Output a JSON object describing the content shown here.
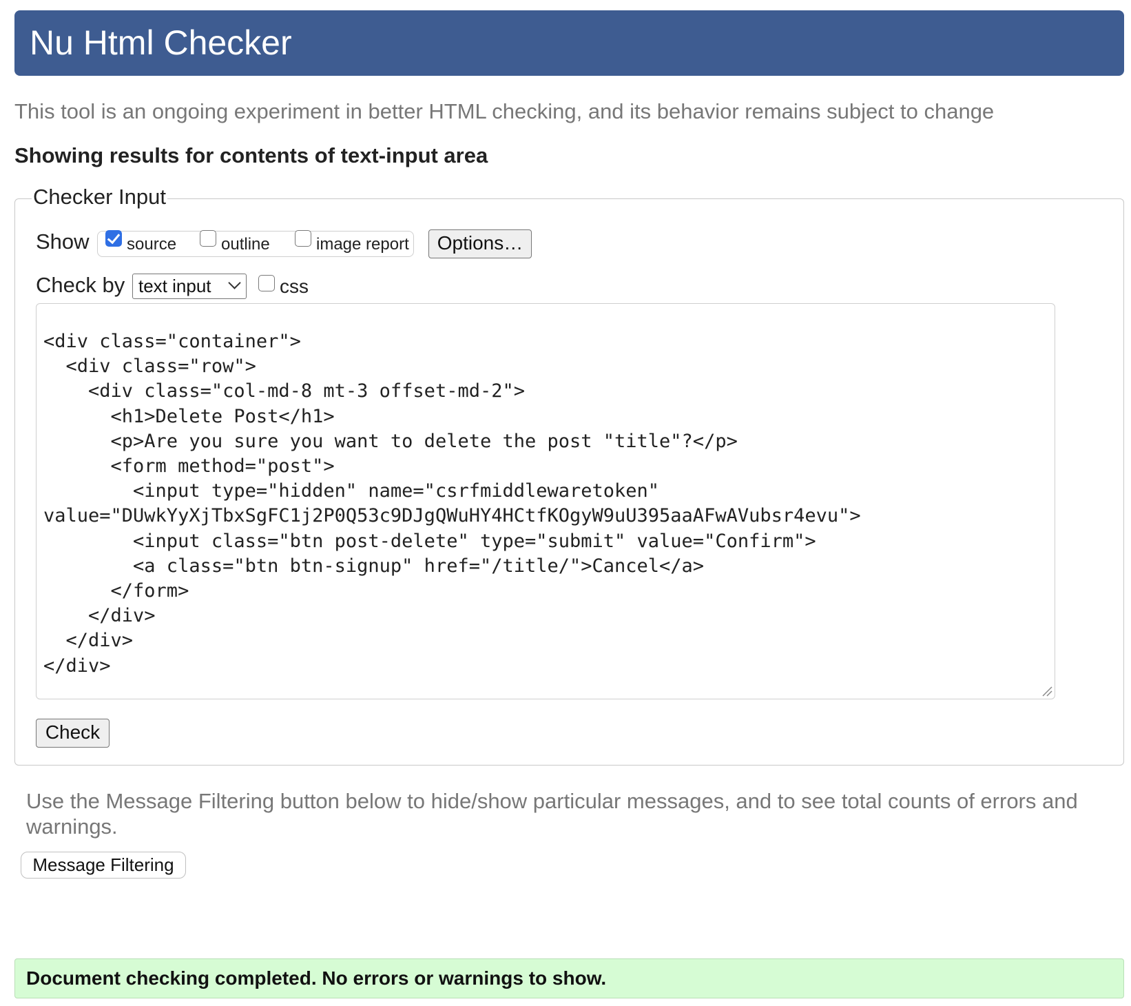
{
  "header": {
    "title": "Nu Html Checker"
  },
  "tagline": "This tool is an ongoing experiment in better HTML checking, and its behavior remains subject to change",
  "results_heading": "Showing results for contents of text-input area",
  "checker_input": {
    "legend": "Checker Input",
    "show_label": "Show",
    "show_options": [
      {
        "label": "source",
        "checked": true
      },
      {
        "label": "outline",
        "checked": false
      },
      {
        "label": "image report",
        "checked": false
      }
    ],
    "options_button": "Options…",
    "check_by_label": "Check by",
    "check_by_selected": "text input",
    "css_label": "css",
    "css_checked": false,
    "source_text": "<div class=\"container\">\n  <div class=\"row\">\n    <div class=\"col-md-8 mt-3 offset-md-2\">\n      <h1>Delete Post</h1>\n      <p>Are you sure you want to delete the post \"title\"?</p>\n      <form method=\"post\">\n        <input type=\"hidden\" name=\"csrfmiddlewaretoken\"\nvalue=\"DUwkYyXjTbxSgFC1j2P0Q53c9DJgQWuHY4HCtfKOgyW9uU395aaAFwAVubsr4evu\">\n        <input class=\"btn post-delete\" type=\"submit\" value=\"Confirm\">\n        <a class=\"btn btn-signup\" href=\"/title/\">Cancel</a>\n      </form>\n    </div>\n  </div>\n</div>",
    "check_button": "Check"
  },
  "filter_note": "Use the Message Filtering button below to hide/show particular messages, and to see total counts of errors and warnings.",
  "filter_button": "Message Filtering",
  "status_message": "Document checking completed. No errors or warnings to show.",
  "colors": {
    "header_bg": "#3e5c91",
    "success_bg": "#d6fcd4",
    "checkbox_accent": "#2f6fe4",
    "muted_text": "#777777"
  }
}
